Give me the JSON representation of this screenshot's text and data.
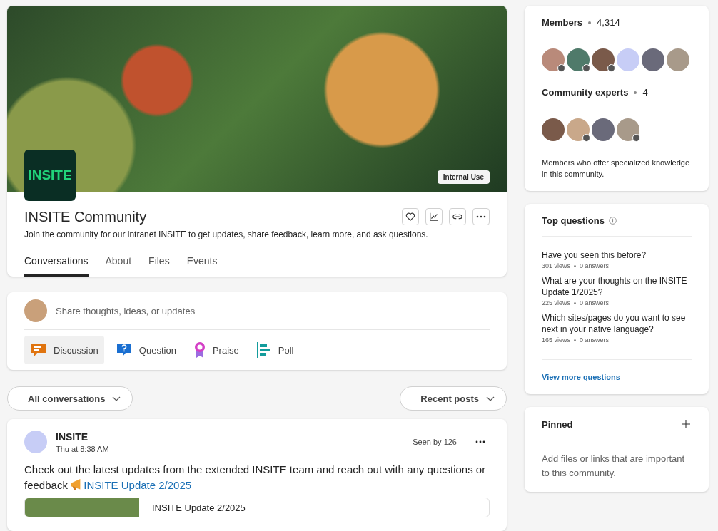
{
  "header": {
    "badge": "Internal Use",
    "logo": "INSITE",
    "title": "INSITE Community",
    "description": "Join the community for our intranet INSITE to get updates, share feedback, learn more, and ask questions.",
    "tabs": [
      {
        "label": "Conversations",
        "selected": true
      },
      {
        "label": "About",
        "selected": false
      },
      {
        "label": "Files",
        "selected": false
      },
      {
        "label": "Events",
        "selected": false
      }
    ]
  },
  "composer": {
    "placeholder": "Share thoughts, ideas, or updates",
    "types": [
      {
        "kind": "discussion",
        "label": "Discussion",
        "selected": true
      },
      {
        "kind": "question",
        "label": "Question",
        "selected": false
      },
      {
        "kind": "praise",
        "label": "Praise",
        "selected": false
      },
      {
        "kind": "poll",
        "label": "Poll",
        "selected": false
      }
    ]
  },
  "filters": {
    "left": "All conversations",
    "right": "Recent posts"
  },
  "post": {
    "author": "INSITE",
    "time": "Thu at 8:38 AM",
    "seen": "Seen by 126",
    "text": "Check out the latest updates from the extended INSITE team and reach out with any questions or feedback",
    "link": "INSITE Update 2/2025",
    "preview_title": "INSITE Update 2/2025"
  },
  "members": {
    "title": "Members",
    "count": "4,314",
    "avatars": [
      {
        "kind": "photo",
        "badge": true
      },
      {
        "kind": "photo",
        "badge": true
      },
      {
        "kind": "photo",
        "badge": true
      },
      {
        "kind": "blank",
        "badge": false
      },
      {
        "kind": "photo",
        "badge": false
      },
      {
        "kind": "photo",
        "badge": false
      }
    ]
  },
  "experts": {
    "title": "Community experts",
    "count": "4",
    "avatars": [
      {
        "kind": "photo",
        "badge": false
      },
      {
        "kind": "photo",
        "badge": true
      },
      {
        "kind": "photo",
        "badge": false
      },
      {
        "kind": "photo",
        "badge": true
      }
    ],
    "note": "Members who offer specialized knowledge in this community."
  },
  "top_questions": {
    "title": "Top questions",
    "items": [
      {
        "question": "Have you seen this before?",
        "views": "301 views",
        "answers": "0 answers"
      },
      {
        "question": "What are your thoughts on the INSITE Update 1/2025?",
        "views": "225 views",
        "answers": "0 answers"
      },
      {
        "question": "Which sites/pages do you want to see next in your native language?",
        "views": "165 views",
        "answers": "0 answers"
      }
    ],
    "more": "View more questions"
  },
  "pinned": {
    "title": "Pinned",
    "note": "Add files or links that are important to this community."
  }
}
